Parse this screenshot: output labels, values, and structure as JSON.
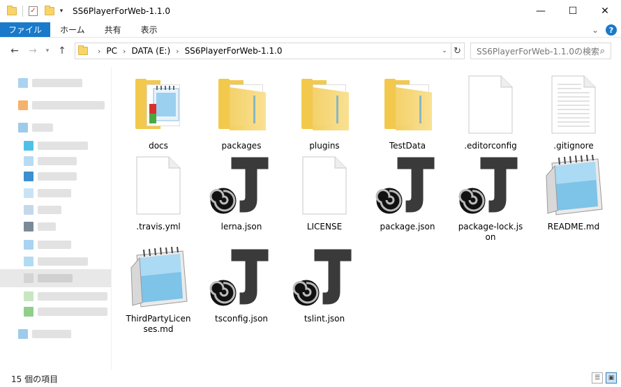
{
  "window": {
    "title": "SS6PlayerForWeb-1.1.0",
    "minimize": "—",
    "maximize": "☐",
    "close": "✕"
  },
  "ribbon": {
    "tabs": [
      "ファイル",
      "ホーム",
      "共有",
      "表示"
    ]
  },
  "address": {
    "crumbs": [
      "PC",
      "DATA (E:)",
      "SS6PlayerForWeb-1.1.0"
    ],
    "search_placeholder": "SS6PlayerForWeb-1.1.0の検索"
  },
  "items": [
    {
      "name": "docs",
      "type": "folder-special"
    },
    {
      "name": "packages",
      "type": "folder"
    },
    {
      "name": "plugins",
      "type": "folder"
    },
    {
      "name": "TestData",
      "type": "folder"
    },
    {
      "name": ".editorconfig",
      "type": "blank"
    },
    {
      "name": ".gitignore",
      "type": "text"
    },
    {
      "name": ".travis.yml",
      "type": "blank"
    },
    {
      "name": "lerna.json",
      "type": "json"
    },
    {
      "name": "LICENSE",
      "type": "blank"
    },
    {
      "name": "package.json",
      "type": "json"
    },
    {
      "name": "package-lock.json",
      "type": "json"
    },
    {
      "name": "README.md",
      "type": "notepad"
    },
    {
      "name": "ThirdPartyLicenses.md",
      "type": "notepad"
    },
    {
      "name": "tsconfig.json",
      "type": "json"
    },
    {
      "name": "tslint.json",
      "type": "json"
    }
  ],
  "status": {
    "count_text": "15 個の項目"
  },
  "colors": {
    "accent": "#1979ca",
    "folder": "#f2c94c"
  }
}
